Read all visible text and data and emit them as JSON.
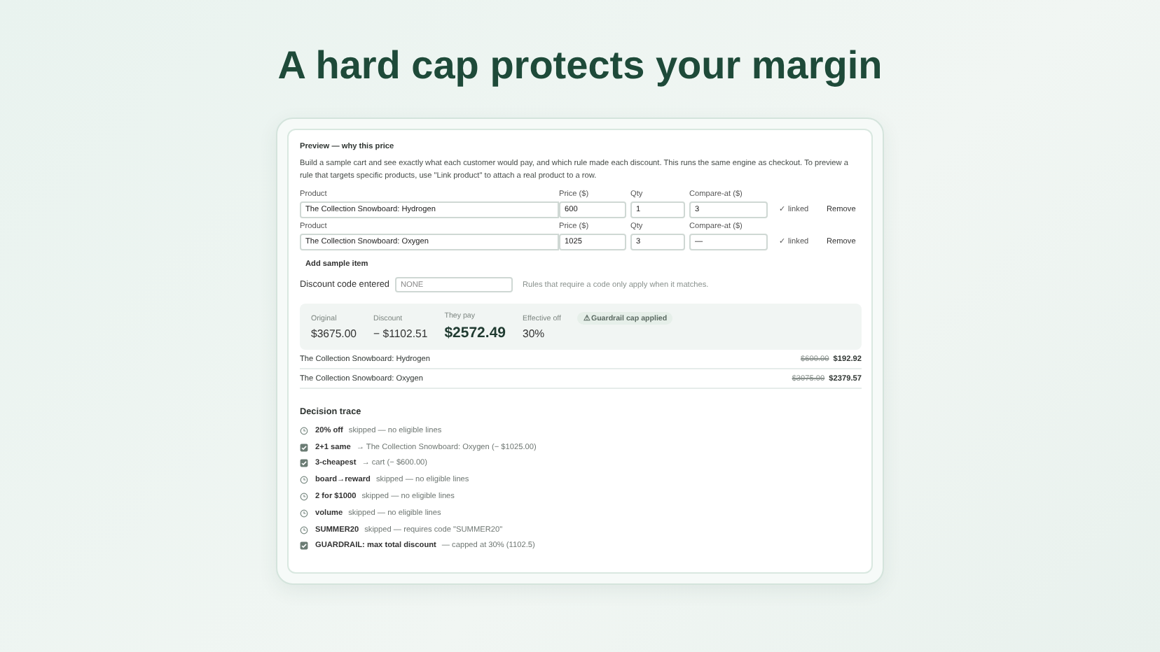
{
  "headline": "A hard cap protects your margin",
  "panel": {
    "title": "Preview — why this price",
    "description": "Build a sample cart and see exactly what each customer would pay, and which rule made each discount. This runs the same engine as checkout. To preview a rule that targets specific products, use \"Link product\" to attach a real product to a row.",
    "items": [
      {
        "labels": [
          "Product",
          "Price ($)",
          "Qty",
          "Compare-at ($)"
        ],
        "product": "The Collection Snowboard: Hydrogen",
        "price": "600",
        "qty": "1",
        "compare_at": "3",
        "linked_label": "✓ linked",
        "remove": "Remove"
      },
      {
        "labels": [
          "Product",
          "Price ($)",
          "Qty",
          "Compare-at ($)"
        ],
        "product": "The Collection Snowboard: Oxygen",
        "price": "1025",
        "qty": "3",
        "compare_at": "—",
        "linked_label": "✓ linked",
        "remove": "Remove"
      }
    ],
    "add_item": "Add sample item",
    "code": {
      "label": "Discount code entered",
      "placeholder": "NONE",
      "hint": "Rules that require a code only apply when it matches."
    },
    "summary": [
      {
        "label": "Original",
        "value": "$3675.00",
        "kind": "plain"
      },
      {
        "label": "Discount",
        "value": "− $1102.51",
        "kind": "plain"
      },
      {
        "label": "They pay",
        "value": "$2572.49",
        "kind": "big"
      },
      {
        "label": "Effective off",
        "value": "30%",
        "kind": "plain"
      }
    ],
    "cap_badge": "⚠ Guardrail cap applied",
    "lines": [
      {
        "name": "The Collection Snowboard: Hydrogen",
        "was": "$600.00",
        "now": "$192.92"
      },
      {
        "name": "The Collection Snowboard: Oxygen",
        "was": "$3075.00",
        "now": "$2379.57"
      }
    ],
    "trace_title": "Decision trace",
    "trace": [
      {
        "rule": "20% off",
        "detail": "skipped — no eligible lines",
        "applied": false
      },
      {
        "rule": "2+1 same",
        "detail": "→ The Collection Snowboard: Oxygen (− $1025.00)",
        "applied": true
      },
      {
        "rule": "3-cheapest",
        "detail": "→ cart (− $600.00)",
        "applied": true
      },
      {
        "rule": "board→reward",
        "detail": "skipped — no eligible lines",
        "applied": false
      },
      {
        "rule": "2 for $1000",
        "detail": "skipped — no eligible lines",
        "applied": false
      },
      {
        "rule": "volume",
        "detail": "skipped — no eligible lines",
        "applied": false
      },
      {
        "rule": "SUMMER20",
        "detail": "skipped — requires code \"SUMMER20\"",
        "applied": false
      },
      {
        "rule": "GUARDRAIL: max total discount",
        "detail": "— capped at 30% (1102.5)",
        "applied": true
      }
    ]
  }
}
